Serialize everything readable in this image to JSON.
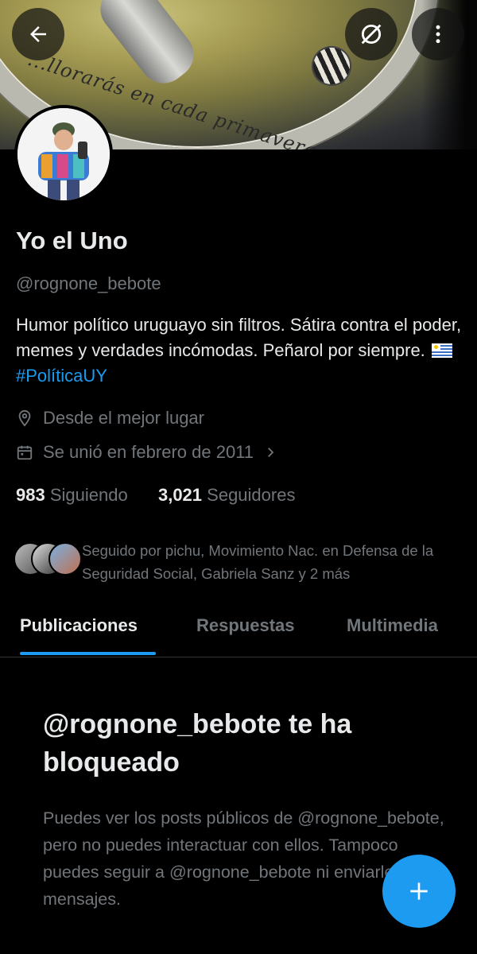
{
  "banner": {
    "inscription": "...llorarás en cada primavera..."
  },
  "header": {
    "back_icon": "arrow-left-icon",
    "grok_icon": "grok-icon",
    "more_icon": "more-vertical-icon"
  },
  "profile": {
    "display_name": "Yo el Uno",
    "handle": "@rognone_bebote",
    "bio_text": "Humor político uruguayo sin filtros. Sátira contra el poder, memes y verdades incómodas. Peñarol por siempre.",
    "bio_hashtag": "#PolíticaUY",
    "location": "Desde el mejor lugar",
    "joined": "Se unió en febrero de 2011",
    "following_count": "983",
    "following_label": "Siguiendo",
    "followers_count": "3,021",
    "followers_label": "Seguidores",
    "followed_by": "Seguido por pichu, Movimiento Nac. en Defensa de la Seguridad Social, Gabriela Sanz y 2 más"
  },
  "tabs": [
    {
      "label": "Publicaciones",
      "active": true
    },
    {
      "label": "Respuestas",
      "active": false
    },
    {
      "label": "Multimedia",
      "active": false
    }
  ],
  "blocked": {
    "title": "@rognone_bebote te ha bloqueado",
    "description": "Puedes ver los posts públicos de @rognone_bebote, pero no puedes interactuar con ellos. Tampoco puedes seguir a @rognone_bebote ni enviarle mensajes."
  },
  "fab": {
    "icon": "plus-icon"
  },
  "colors": {
    "accent": "#1d9bf0",
    "background": "#000000",
    "primary_text": "#e7e9ea",
    "secondary_text": "#71767b"
  }
}
